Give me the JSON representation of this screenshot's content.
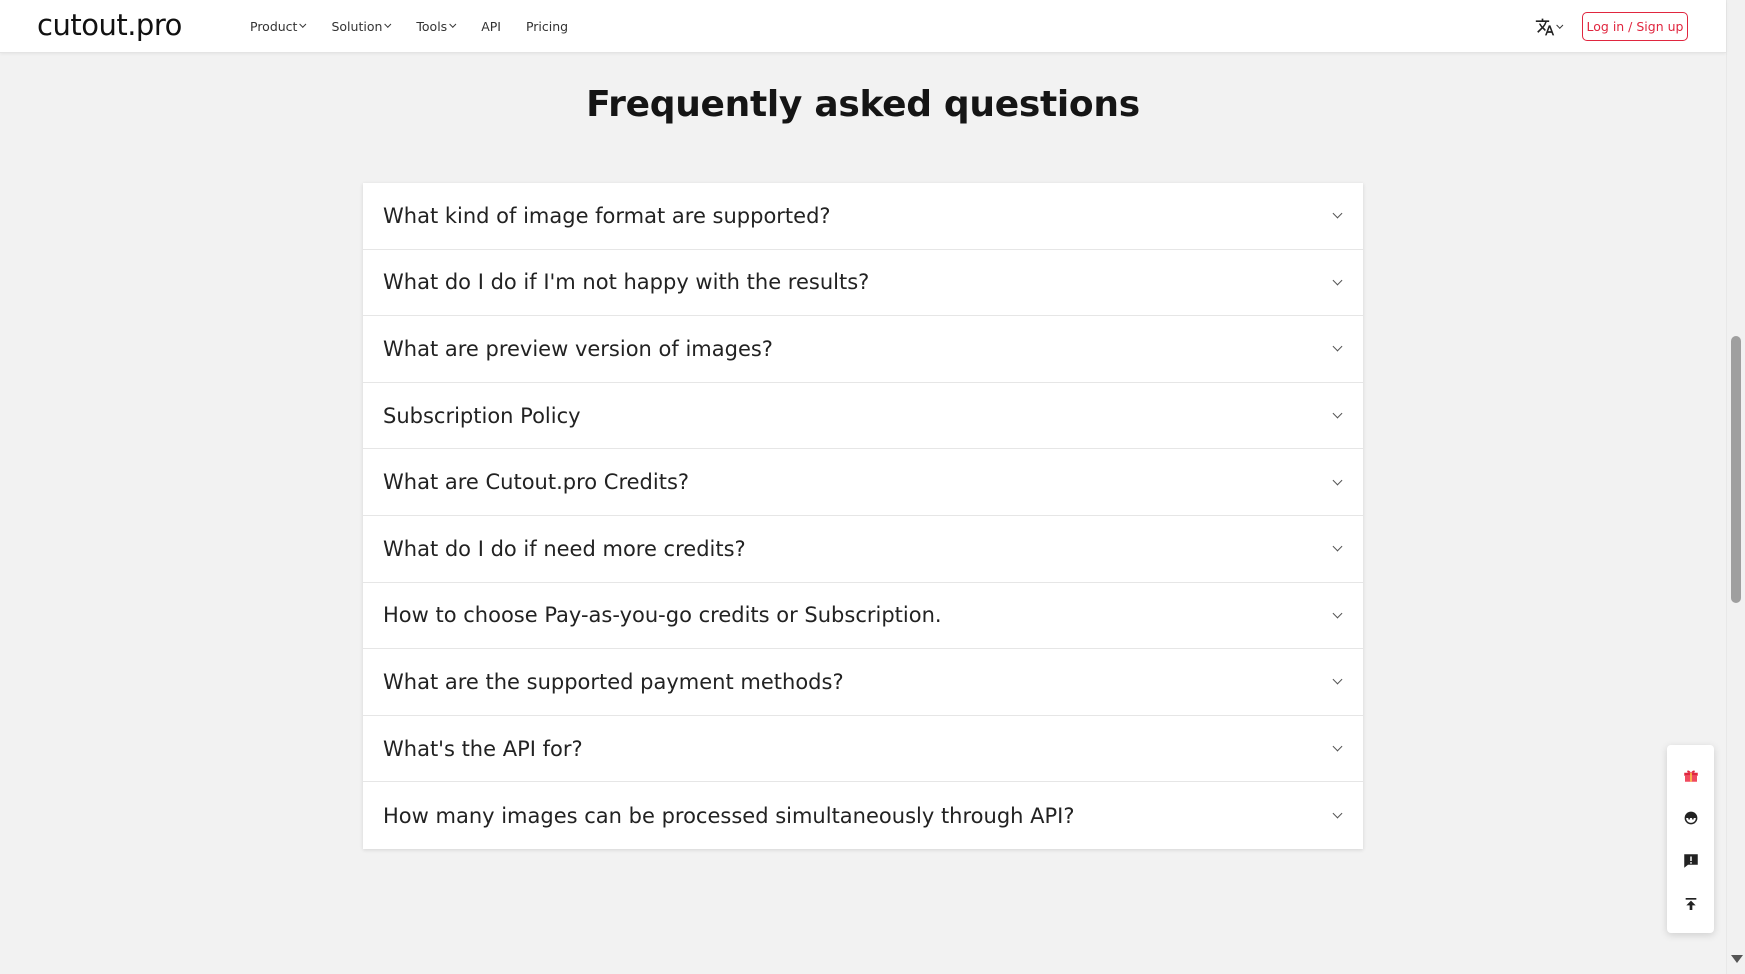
{
  "nav": {
    "logo": "cutout.pro",
    "links": [
      "Product",
      "Solution",
      "Tools",
      "API",
      "Pricing"
    ],
    "login_label": "Log in / Sign up"
  },
  "faq": {
    "title": "Frequently asked questions",
    "questions": [
      "What kind of image format are supported?",
      "What do I do if I'm not happy with the results?",
      "What are preview version of images?",
      "Subscription Policy",
      "What are Cutout.pro Credits?",
      "What do I do if need more credits?",
      "How to choose Pay-as-you-go credits or Subscription.",
      "What are the supported payment methods?",
      "What's the API for?",
      "How many images can be processed simultaneously through API?"
    ]
  },
  "side_panel": {
    "icons": [
      "gift-icon",
      "customer-service-icon",
      "feedback-icon",
      "back-to-top-icon"
    ]
  },
  "colors": {
    "accent": "#e0263f",
    "background": "#f2f2f2"
  }
}
